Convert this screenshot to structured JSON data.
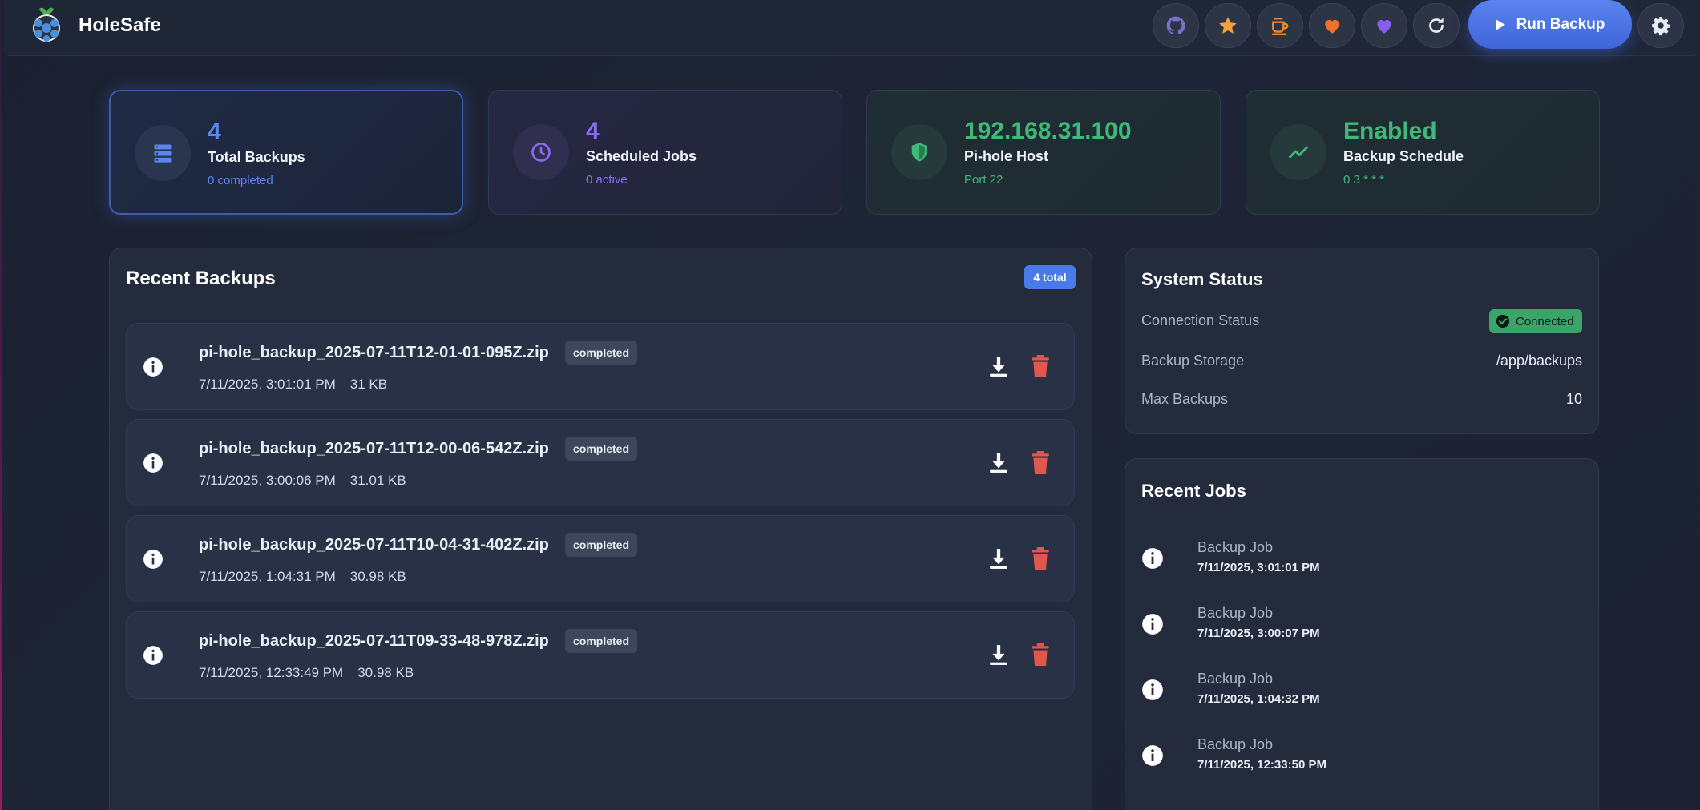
{
  "app": {
    "brand": "HoleSafe"
  },
  "header": {
    "buttons": [
      {
        "icon": "github-icon",
        "color": "#7b6fc9"
      },
      {
        "icon": "star-icon",
        "color": "#f0a13a"
      },
      {
        "icon": "coffee-icon",
        "color": "#f08a2a"
      },
      {
        "icon": "heart-icon",
        "color": "#f0722a"
      },
      {
        "icon": "heart-icon",
        "color": "#8a5cf0"
      },
      {
        "icon": "refresh-icon",
        "color": "#e6ebf5"
      }
    ],
    "run_label": "Run Backup",
    "settings_icon": "gear-icon"
  },
  "stats": [
    {
      "value": "4",
      "label": "Total Backups",
      "sub": "0 completed",
      "icon": "database-icon",
      "color": "#5b86f0"
    },
    {
      "value": "4",
      "label": "Scheduled Jobs",
      "sub": "0 active",
      "icon": "clock-icon",
      "color": "#8b6cf0"
    },
    {
      "value": "192.168.31.100",
      "label": "Pi-hole Host",
      "sub": "Port 22",
      "icon": "shield-icon",
      "color": "#3fb978"
    },
    {
      "value": "Enabled",
      "label": "Backup Schedule",
      "sub": "0 3 * * *",
      "icon": "trend-icon",
      "color": "#3fb978"
    }
  ],
  "recent_backups": {
    "title": "Recent Backups",
    "count_badge": "4 total",
    "items": [
      {
        "name": "pi-hole_backup_2025-07-11T12-01-01-095Z.zip",
        "status": "completed",
        "date": "7/11/2025, 3:01:01 PM",
        "size": "31 KB"
      },
      {
        "name": "pi-hole_backup_2025-07-11T12-00-06-542Z.zip",
        "status": "completed",
        "date": "7/11/2025, 3:00:06 PM",
        "size": "31.01 KB"
      },
      {
        "name": "pi-hole_backup_2025-07-11T10-04-31-402Z.zip",
        "status": "completed",
        "date": "7/11/2025, 1:04:31 PM",
        "size": "30.98 KB"
      },
      {
        "name": "pi-hole_backup_2025-07-11T09-33-48-978Z.zip",
        "status": "completed",
        "date": "7/11/2025, 12:33:49 PM",
        "size": "30.98 KB"
      }
    ]
  },
  "system_status": {
    "title": "System Status",
    "rows": [
      {
        "label": "Connection Status",
        "value": "Connected"
      },
      {
        "label": "Backup Storage",
        "value": "/app/backups"
      },
      {
        "label": "Max Backups",
        "value": "10"
      }
    ]
  },
  "recent_jobs": {
    "title": "Recent Jobs",
    "items": [
      {
        "title": "Backup Job",
        "date": "7/11/2025, 3:01:01 PM"
      },
      {
        "title": "Backup Job",
        "date": "7/11/2025, 3:00:07 PM"
      },
      {
        "title": "Backup Job",
        "date": "7/11/2025, 1:04:32 PM"
      },
      {
        "title": "Backup Job",
        "date": "7/11/2025, 12:33:50 PM"
      }
    ]
  }
}
